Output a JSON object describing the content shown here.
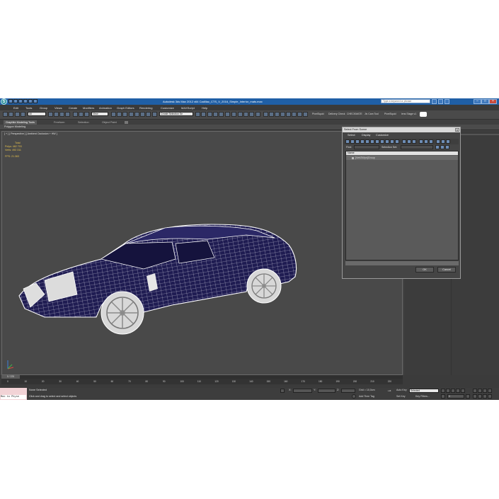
{
  "app": {
    "window_title": "Autodesk 3ds Max 2012 x64     Cadillac_CTS_V_2016_Simple_Interior_mats.max",
    "search_placeholder": "Type a keyword or phrase",
    "menu": [
      "Edit",
      "Tools",
      "Group",
      "Views",
      "Create",
      "Modifiers",
      "Animation",
      "Graph Editors",
      "Rendering",
      "Customize",
      "MAXScript",
      "Help"
    ]
  },
  "toolbar": {
    "selection_filter": "All",
    "reference_coord": "View",
    "named_selection": "Create Selection Se",
    "plugins": [
      "PixelSquid",
      "Delivery Check",
      "CHECKMATE",
      "Jiv Cam Tool",
      "PixelSquid",
      "lens Stage v1"
    ]
  },
  "ribbon": {
    "tabs": [
      "Graphite Modeling Tools",
      "Freeform",
      "Selection",
      "Object Paint"
    ],
    "panel_label": "Polygon Modeling"
  },
  "viewport": {
    "label": "[ + ] [ Perspective ] [ Ambient Occlusion + HW ]",
    "stats_header": "Total",
    "polys_label": "Polys:",
    "polys_value": "482 703",
    "verts_label": "Verts:",
    "verts_value": "492 311",
    "fps_label": "FPS:",
    "fps_value": "21.363",
    "axis_x": "x",
    "axis_z": "z"
  },
  "timeline": {
    "frame_counter": "0 / 225",
    "ticks": [
      "0",
      "10",
      "20",
      "30",
      "40",
      "50",
      "60",
      "70",
      "80",
      "90",
      "100",
      "110",
      "120",
      "130",
      "140",
      "150",
      "160",
      "170",
      "180",
      "190",
      "200",
      "210",
      "220"
    ]
  },
  "status": {
    "maxscript": "Max to Physe",
    "selection": "None Selected",
    "prompt": "Click and drag to select and select objects",
    "x_label": "X:",
    "y_label": "Y:",
    "z_label": "Z:",
    "grid": "Grid = 10,0cm",
    "add_time_tag": "Add Time Tag",
    "auto_key": "Auto Key",
    "auto_key_value": "Selected",
    "set_key": "Set Key",
    "key_filters": "Key Filters...",
    "frame_value": "0"
  },
  "dialog": {
    "title": "Select From Scene",
    "close": "x",
    "menu": [
      "Select",
      "Display",
      "Customize"
    ],
    "find_label": "Find:",
    "selection_set_label": "Selection Set:",
    "column_name": "Name",
    "row": "[Vert2Wpn]Group",
    "ok": "OK",
    "cancel": "Cancel"
  },
  "colors": {
    "title_bar": "#1f5fa6",
    "viewport_bg": "#494949",
    "stats_text": "#e7c24c",
    "car_wire": "#ffffff",
    "car_body": "#1f1c52",
    "maxscript_bg": "#f2d3d6"
  }
}
